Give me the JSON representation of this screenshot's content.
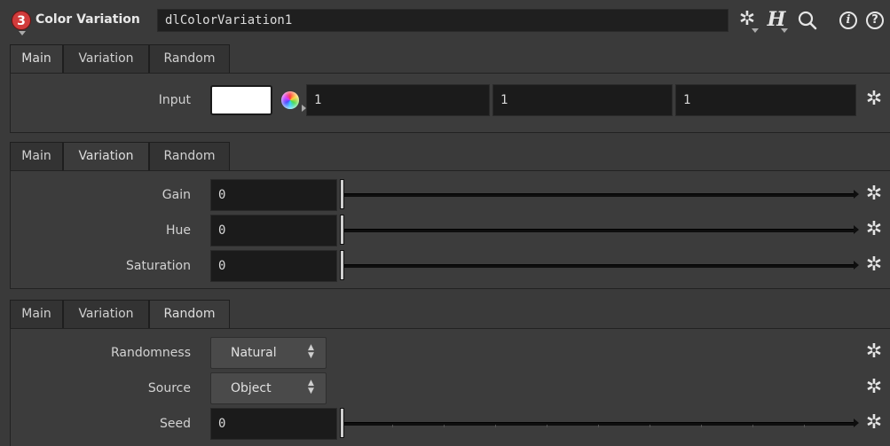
{
  "header": {
    "node_badge": "3",
    "node_type": "Color Variation",
    "node_name": "dlColorVariation1",
    "icons": [
      "gear-icon",
      "houdini-h-icon",
      "search-icon",
      "info-icon",
      "help-icon"
    ],
    "info_glyph": "i",
    "help_glyph": "?"
  },
  "tabs": [
    "Main",
    "Variation",
    "Random"
  ],
  "main": {
    "input_label": "Input",
    "input_color": "#ffffff",
    "input_values": [
      "1",
      "1",
      "1"
    ]
  },
  "variation": {
    "rows": [
      {
        "label": "Gain",
        "value": "0"
      },
      {
        "label": "Hue",
        "value": "0"
      },
      {
        "label": "Saturation",
        "value": "0"
      }
    ]
  },
  "random": {
    "randomness_label": "Randomness",
    "randomness_value": "Natural",
    "source_label": "Source",
    "source_value": "Object",
    "seed_label": "Seed",
    "seed_value": "0"
  },
  "colors": {
    "background": "#3a3a3a",
    "field": "#1b1b1b",
    "node_badge": "#d13b3b"
  }
}
